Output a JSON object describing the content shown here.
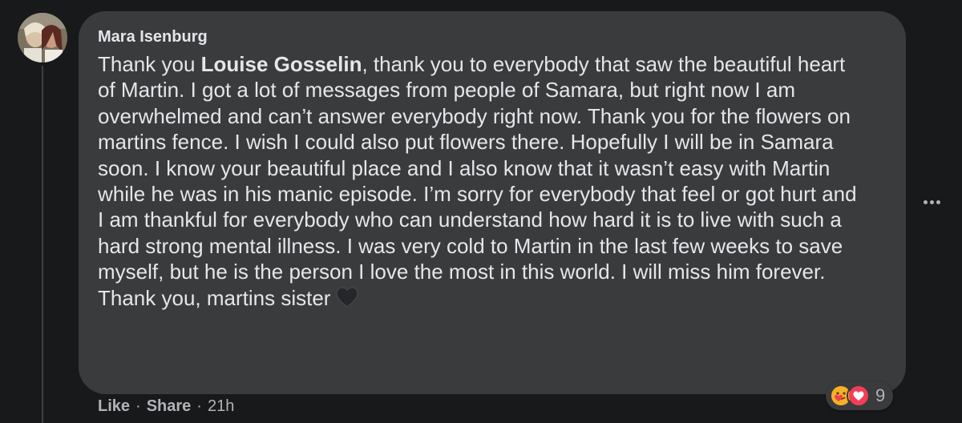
{
  "comment": {
    "author": "Mara Isenburg",
    "text_intro": "Thank you ",
    "mention": "Louise Gosselin",
    "text_body": ", thank you to everybody that saw the beautiful heart of Martin. I got a lot of messages from people of Samara, but right now I am overwhelmed and can’t answer everybody right now. Thank you for the flowers on martins fence. I wish I could also put flowers there. Hopefully I will be in Samara soon. I know your beautiful place and I also know that it wasn’t easy with Martin while he was in his manic episode. I’m sorry for everybody that feel or got hurt and I am thankful for everybody who can understand how hard it is to live with such a hard strong mental illness. I was very cold to Martin in the last few weeks to save myself, but he is the person I love the most in this world. I will miss him forever. Thank you, martins sister",
    "trailing_emoji": "black-heart-icon"
  },
  "reactions": {
    "icons": [
      "care-icon",
      "love-icon"
    ],
    "count": "9"
  },
  "actions": {
    "like": "Like",
    "separator": "·",
    "share": "Share",
    "time": "21h"
  },
  "colors": {
    "background": "#18191a",
    "bubble": "#3a3b3c",
    "text_primary": "#e4e6eb",
    "text_secondary": "#b0b3b8",
    "love_red": "#f33e58",
    "care_yellow": "#f7b125"
  }
}
